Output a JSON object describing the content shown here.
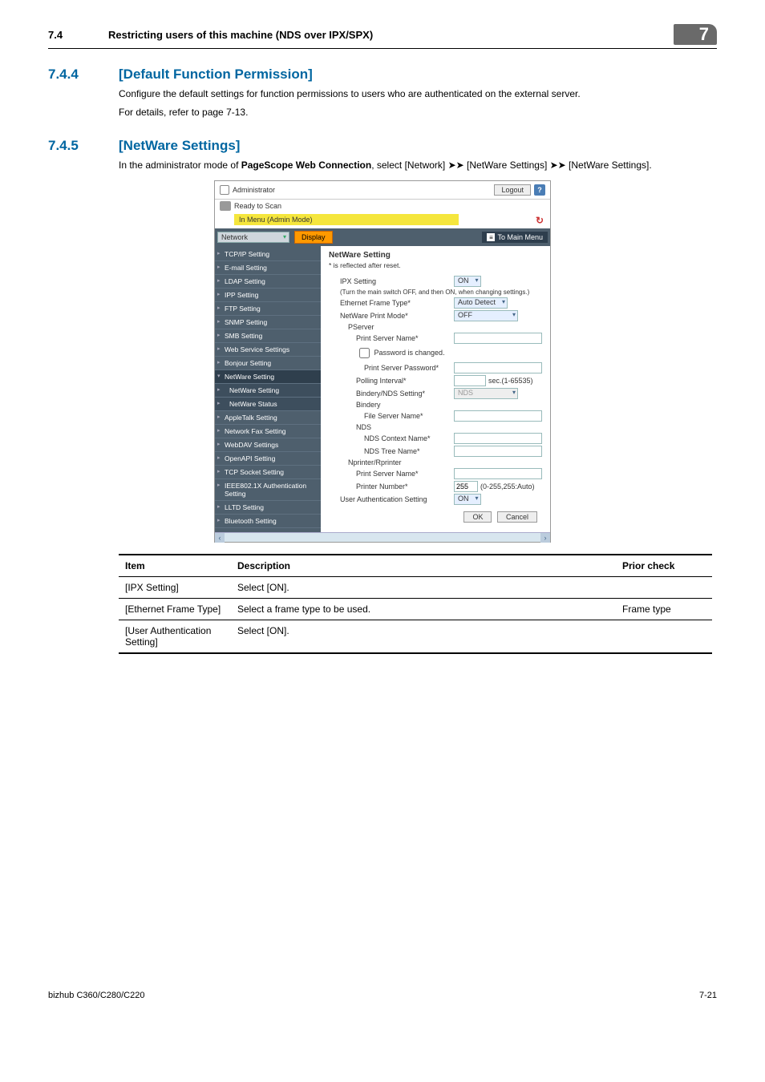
{
  "header": {
    "section_num": "7.4",
    "section_title": "Restricting users of this machine (NDS over IPX/SPX)",
    "chapter": "7"
  },
  "sec_744": {
    "num": "7.4.4",
    "title": "[Default Function Permission]",
    "p1": "Configure the default settings for function permissions to users who are authenticated on the external server.",
    "p2": "For details, refer to page 7-13."
  },
  "sec_745": {
    "num": "7.4.5",
    "title": "[NetWare Settings]",
    "p1a": "In the administrator mode of ",
    "p1b": "PageScope Web Connection",
    "p1c": ", select [Network] ➤➤ [NetWare Settings] ➤➤ [NetWare Settings]."
  },
  "shot": {
    "admin_label": "Administrator",
    "logout": "Logout",
    "help": "?",
    "ready": "Ready to Scan",
    "yellow": "In Menu (Admin Mode)",
    "dropdown": "Network",
    "display_btn": "Display",
    "to_main": "To Main Menu",
    "nav": [
      "TCP/IP Setting",
      "E-mail Setting",
      "LDAP Setting",
      "IPP Setting",
      "FTP Setting",
      "SNMP Setting",
      "SMB Setting",
      "Web Service Settings",
      "Bonjour Setting",
      "NetWare Setting",
      "NetWare Setting",
      "NetWare Status",
      "AppleTalk Setting",
      "Network Fax Setting",
      "WebDAV Settings",
      "OpenAPI Setting",
      "TCP Socket Setting",
      "IEEE802.1X Authentication Setting",
      "LLTD Setting",
      "Bluetooth Setting"
    ],
    "content": {
      "heading": "NetWare Setting",
      "note": "* is reflected after reset.",
      "ipx_label": "IPX Setting",
      "ipx_val": "ON",
      "ipx_hint": "(Turn the main switch OFF, and then ON, when changing settings.)",
      "eth_label": "Ethernet Frame Type*",
      "eth_val": "Auto Detect",
      "mode_label": "NetWare Print Mode*",
      "mode_val": "OFF",
      "pserver": "PServer",
      "psn_label": "Print Server Name*",
      "pw_chk": "Password is changed.",
      "psw_label": "Print Server Password*",
      "poll_label": "Polling Interval*",
      "poll_hint": "sec.(1-65535)",
      "bnds_label": "Bindery/NDS Setting*",
      "bnds_val": "NDS",
      "bindery": "Bindery",
      "fsn_label": "File Server Name*",
      "nds": "NDS",
      "ndsctx_label": "NDS Context Name*",
      "ndstree_label": "NDS Tree Name*",
      "nprinter": "Nprinter/Rprinter",
      "npsn_label": "Print Server Name*",
      "pnum_label": "Printer Number*",
      "pnum_val": "255",
      "pnum_hint": "(0-255,255:Auto)",
      "uauth_label": "User Authentication Setting",
      "uauth_val": "ON",
      "ok": "OK",
      "cancel": "Cancel"
    }
  },
  "table": {
    "h1": "Item",
    "h2": "Description",
    "h3": "Prior check",
    "rows": [
      {
        "item": "[IPX Setting]",
        "desc": "Select [ON].",
        "prior": ""
      },
      {
        "item": "[Ethernet Frame Type]",
        "desc": "Select a frame type to be used.",
        "prior": "Frame type"
      },
      {
        "item": "[User Authentication Setting]",
        "desc": "Select [ON].",
        "prior": ""
      }
    ]
  },
  "footer": {
    "left": "bizhub C360/C280/C220",
    "right": "7-21"
  }
}
